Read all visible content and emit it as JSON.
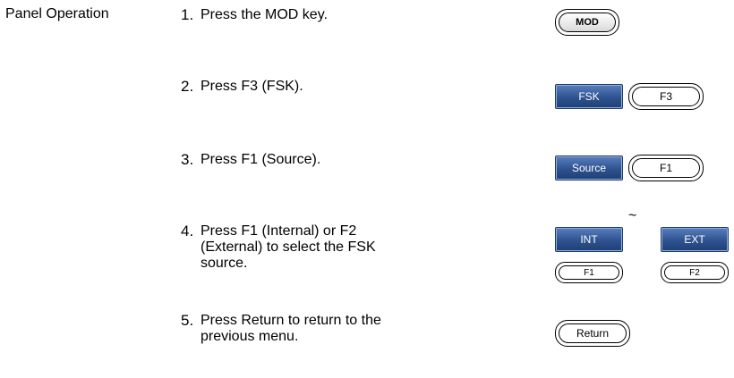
{
  "section_label": "Panel Operation",
  "steps": [
    {
      "num": "1.",
      "text": "Press the MOD key."
    },
    {
      "num": "2.",
      "text": "Press F3 (FSK)."
    },
    {
      "num": "3.",
      "text": "Press F1 (Source)."
    },
    {
      "num": "4.",
      "text": "Press F1 (Internal) or F2 (External) to select the FSK source."
    },
    {
      "num": "5.",
      "text": "Press Return to return to the previous menu."
    }
  ],
  "keys": {
    "mod": "MOD",
    "fsk_softkey": "FSK",
    "f3": "F3",
    "source_softkey": "Source",
    "f1_source": "F1",
    "int_softkey": "INT",
    "range_symbol": "~",
    "ext_softkey": "EXT",
    "f1_small": "F1",
    "f2_small": "F2",
    "return": "Return"
  }
}
